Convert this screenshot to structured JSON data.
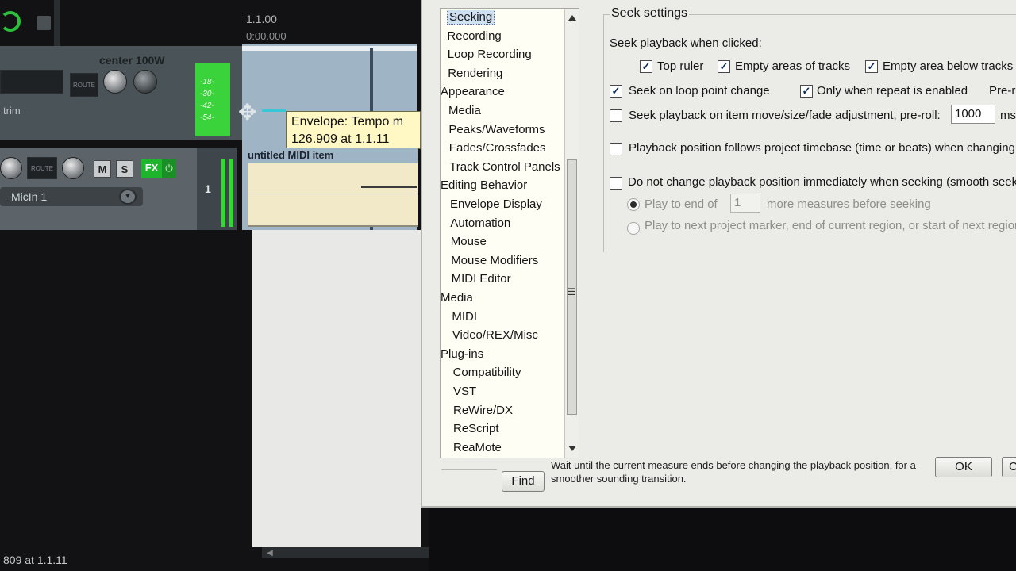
{
  "daw": {
    "ruler_time": "1.1.00",
    "ruler_seconds": "0:00.000",
    "track1_pan_label": "center  100W",
    "trim_label": "trim",
    "meter_ticks": [
      "-18-",
      "-30-",
      "-42-",
      "-54-"
    ],
    "mute_label": "M",
    "solo_label": "S",
    "fx_label": "FX",
    "track2_input": "MicIn 1",
    "track2_number": "1",
    "route_label": "ROUTE",
    "tooltip_line1": "Envelope: Tempo m",
    "tooltip_line2": "126.909 at 1.1.11",
    "midi_item_title": "untitled MIDI item",
    "status_text": "809 at 1.1.11",
    "colors": {
      "meter": "#3bd33b",
      "fx": "#1db52c",
      "arrange": "#9fb4c4",
      "midi_item": "#f2e9c8"
    }
  },
  "prefs": {
    "tree": [
      {
        "label": "Seeking",
        "level": 1,
        "selected": true
      },
      {
        "label": "Recording",
        "level": 1
      },
      {
        "label": "Loop Recording",
        "level": 1
      },
      {
        "label": "Rendering",
        "level": 1
      },
      {
        "label": "Appearance",
        "level": 0
      },
      {
        "label": "Media",
        "level": 1
      },
      {
        "label": "Peaks/Waveforms",
        "level": 1
      },
      {
        "label": "Fades/Crossfades",
        "level": 1
      },
      {
        "label": "Track Control Panels",
        "level": 1
      },
      {
        "label": "Editing Behavior",
        "level": 0
      },
      {
        "label": "Envelope Display",
        "level": 1
      },
      {
        "label": "Automation",
        "level": 1
      },
      {
        "label": "Mouse",
        "level": 1
      },
      {
        "label": "Mouse Modifiers",
        "level": 1
      },
      {
        "label": "MIDI Editor",
        "level": 1
      },
      {
        "label": "Media",
        "level": 0
      },
      {
        "label": "MIDI",
        "level": 1
      },
      {
        "label": "Video/REX/Misc",
        "level": 1
      },
      {
        "label": "Plug-ins",
        "level": 0
      },
      {
        "label": "Compatibility",
        "level": 1
      },
      {
        "label": "VST",
        "level": 1
      },
      {
        "label": "ReWire/DX",
        "level": 1
      },
      {
        "label": "ReScript",
        "level": 1
      },
      {
        "label": "ReaMote",
        "level": 1
      }
    ],
    "group_title": "Seek settings",
    "seek_clicked_label": "Seek playback when clicked:",
    "top_ruler": "Top ruler",
    "empty_areas": "Empty areas of tracks",
    "empty_below": "Empty area below tracks",
    "loop_change": "Seek on loop point change",
    "only_repeat": "Only when repeat is enabled",
    "preroll_cut": "Pre-ro",
    "item_move": "Seek playback on item move/size/fade adjustment, pre-roll:",
    "preroll_value": "1000",
    "ms_label": "ms",
    "follows_timebase": "Playback position follows project timebase (time or beats) when changing t",
    "smooth_seek": "Do not change playback position immediately when seeking (smooth seek",
    "play_to_end_of": "Play to end of",
    "measures_value": "1",
    "more_measures": "more measures before seeking",
    "play_to_next": "Play to next project marker, end of current region, or start of next region",
    "find_label": "Find",
    "hint_text": "Wait until the current measure ends before changing the playback position, for a smoother sounding transition.",
    "ok_label": "OK",
    "cancel_cut": "C",
    "checks": {
      "top_ruler": true,
      "empty_areas": true,
      "empty_below": true,
      "loop_change": true,
      "only_repeat": true,
      "item_move": false,
      "follows_timebase": false,
      "smooth_seek": false
    },
    "radio_selected": "play_to_end_of"
  }
}
